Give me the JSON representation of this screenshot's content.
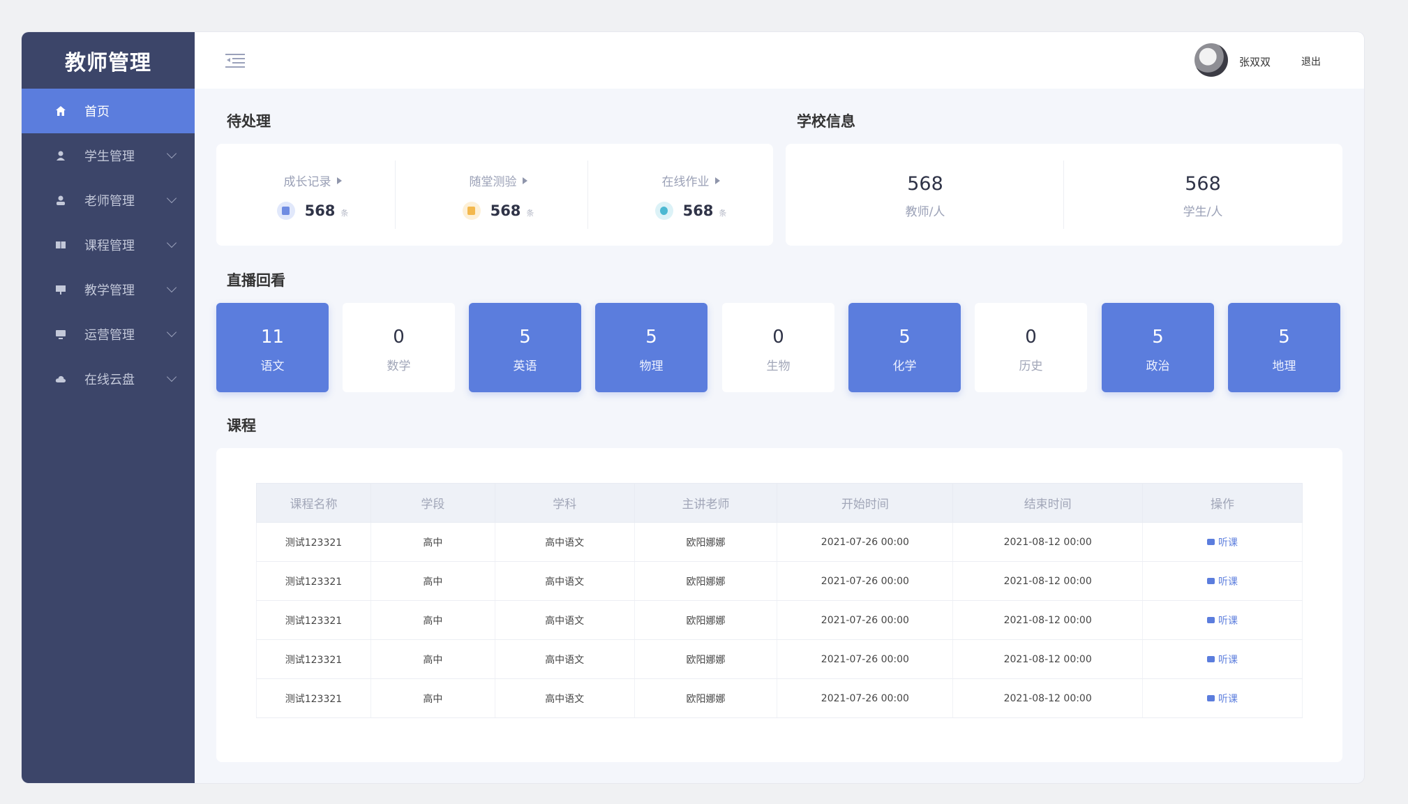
{
  "sidebar": {
    "title": "教师管理",
    "items": [
      {
        "label": "首页"
      },
      {
        "label": "学生管理"
      },
      {
        "label": "老师管理"
      },
      {
        "label": "课程管理"
      },
      {
        "label": "教学管理"
      },
      {
        "label": "运营管理"
      },
      {
        "label": "在线云盘"
      }
    ]
  },
  "header": {
    "username": "张双双",
    "logout": "退出"
  },
  "pending": {
    "title": "待处理",
    "items": [
      {
        "label": "成长记录",
        "value": "568",
        "unit": "条"
      },
      {
        "label": "随堂测验",
        "value": "568",
        "unit": "条"
      },
      {
        "label": "在线作业",
        "value": "568",
        "unit": "条"
      }
    ]
  },
  "school": {
    "title": "学校信息",
    "items": [
      {
        "value": "568",
        "label": "教师/人"
      },
      {
        "value": "568",
        "label": "学生/人"
      }
    ]
  },
  "live": {
    "title": "直播回看",
    "subjects": [
      {
        "count": "11",
        "label": "语文"
      },
      {
        "count": "0",
        "label": "数学"
      },
      {
        "count": "5",
        "label": "英语"
      },
      {
        "count": "5",
        "label": "物理"
      },
      {
        "count": "0",
        "label": "生物"
      },
      {
        "count": "5",
        "label": "化学"
      },
      {
        "count": "0",
        "label": "历史"
      },
      {
        "count": "5",
        "label": "政治"
      },
      {
        "count": "5",
        "label": "地理"
      }
    ]
  },
  "courses": {
    "title": "课程",
    "columns": [
      "课程名称",
      "学段",
      "学科",
      "主讲老师",
      "开始时间",
      "结束时间",
      "操作"
    ],
    "action": "听课",
    "rows": [
      [
        "测试123321",
        "高中",
        "高中语文",
        "欧阳娜娜",
        "2021-07-26 00:00",
        "2021-08-12 00:00"
      ],
      [
        "测试123321",
        "高中",
        "高中语文",
        "欧阳娜娜",
        "2021-07-26 00:00",
        "2021-08-12 00:00"
      ],
      [
        "测试123321",
        "高中",
        "高中语文",
        "欧阳娜娜",
        "2021-07-26 00:00",
        "2021-08-12 00:00"
      ],
      [
        "测试123321",
        "高中",
        "高中语文",
        "欧阳娜娜",
        "2021-07-26 00:00",
        "2021-08-12 00:00"
      ],
      [
        "测试123321",
        "高中",
        "高中语文",
        "欧阳娜娜",
        "2021-07-26 00:00",
        "2021-08-12 00:00"
      ]
    ]
  },
  "colors": {
    "accent": "#5b7ddd",
    "sidebar_bg": "#3c4569"
  }
}
